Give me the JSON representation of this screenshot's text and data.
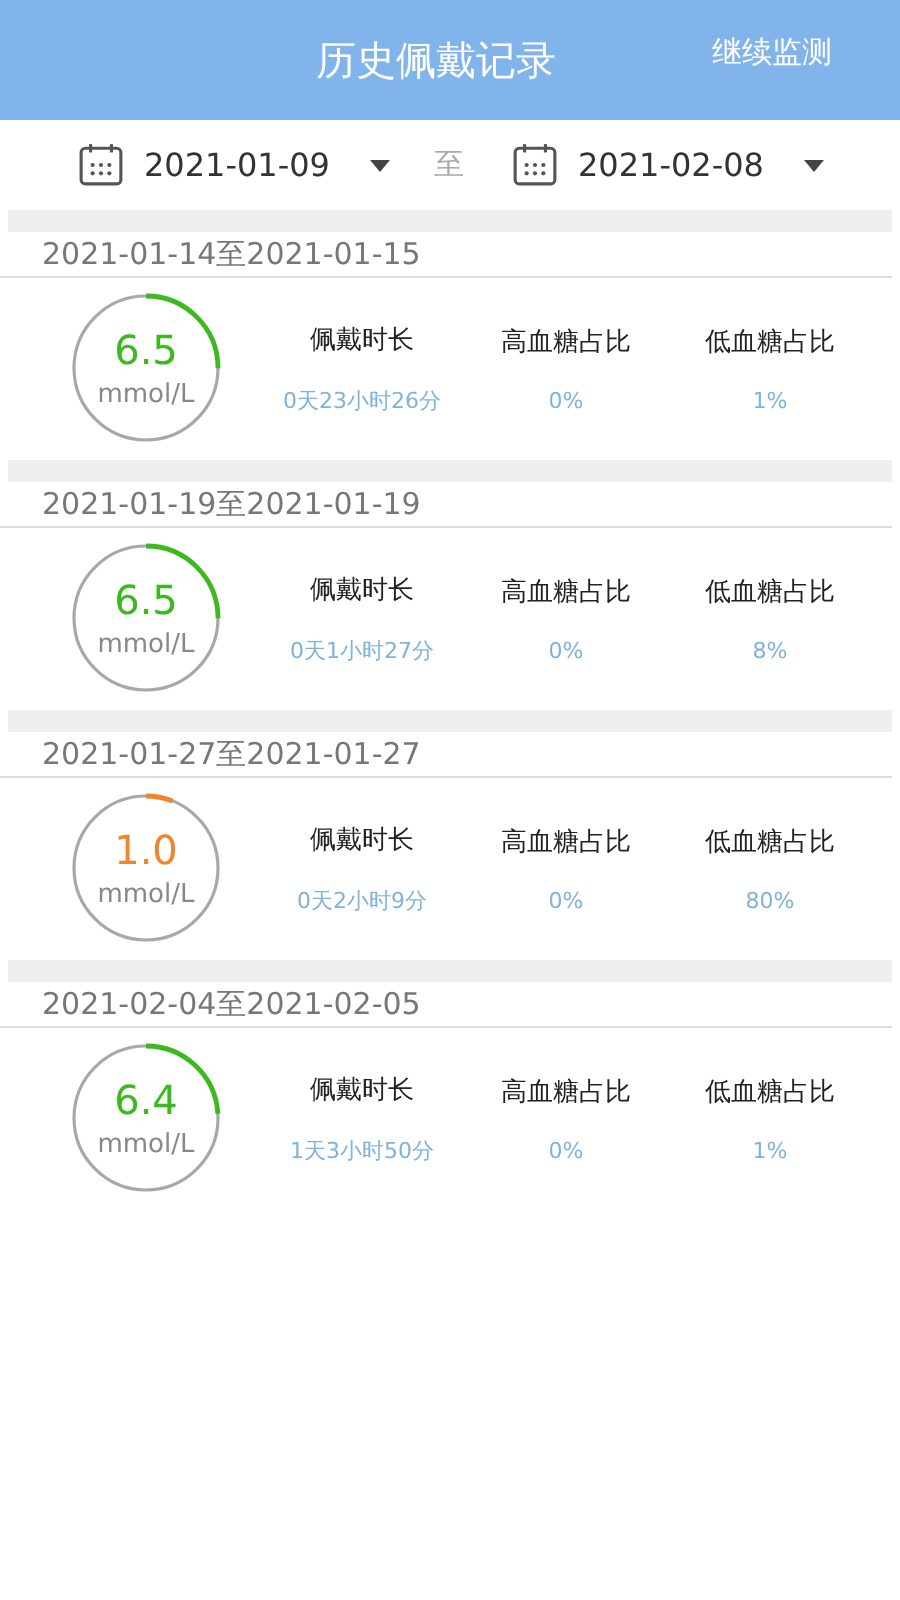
{
  "header": {
    "title": "历史佩戴记录",
    "action": "继续监测"
  },
  "date_range": {
    "start": "2021-01-09",
    "separator": "至",
    "end": "2021-02-08"
  },
  "records": [
    {
      "period": "2021-01-14至2021-01-15",
      "value": "6.5",
      "unit": "mmol/L",
      "level": 0.25,
      "color": "#3cb91e",
      "stats": [
        {
          "label": "佩戴时长",
          "value": "0天23小时26分"
        },
        {
          "label": "高血糖占比",
          "value": "0%"
        },
        {
          "label": "低血糖占比",
          "value": "1%"
        }
      ]
    },
    {
      "period": "2021-01-19至2021-01-19",
      "value": "6.5",
      "unit": "mmol/L",
      "level": 0.25,
      "color": "#3cb91e",
      "stats": [
        {
          "label": "佩戴时长",
          "value": "0天1小时27分"
        },
        {
          "label": "高血糖占比",
          "value": "0%"
        },
        {
          "label": "低血糖占比",
          "value": "8%"
        }
      ]
    },
    {
      "period": "2021-01-27至2021-01-27",
      "value": "1.0",
      "unit": "mmol/L",
      "level": 0.06,
      "color": "#f0852a",
      "stats": [
        {
          "label": "佩戴时长",
          "value": "0天2小时9分"
        },
        {
          "label": "高血糖占比",
          "value": "0%"
        },
        {
          "label": "低血糖占比",
          "value": "80%"
        }
      ]
    },
    {
      "period": "2021-02-04至2021-02-05",
      "value": "6.4",
      "unit": "mmol/L",
      "level": 0.24,
      "color": "#3cb91e",
      "stats": [
        {
          "label": "佩戴时长",
          "value": "1天3小时50分"
        },
        {
          "label": "高血糖占比",
          "value": "0%"
        },
        {
          "label": "低血糖占比",
          "value": "1%"
        }
      ]
    }
  ]
}
